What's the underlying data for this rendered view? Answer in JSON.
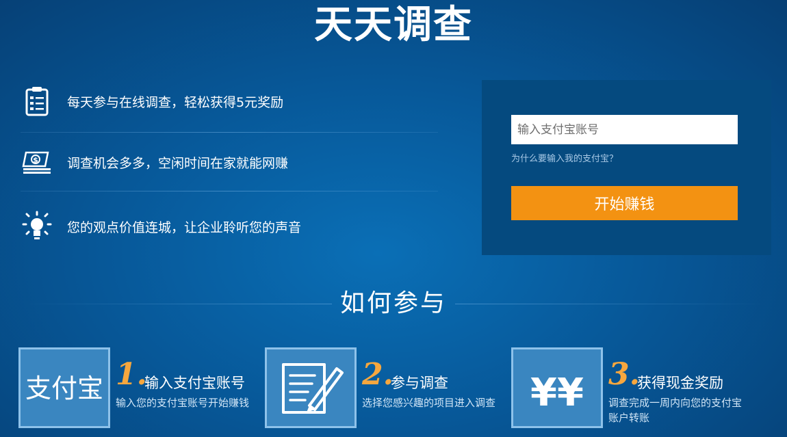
{
  "header": {
    "title": "天天调查"
  },
  "features": [
    {
      "icon": "clipboard-icon",
      "text": "每天参与在线调查，轻松获得5元奖励"
    },
    {
      "icon": "money-icon",
      "text": "调查机会多多，空闲时间在家就能网赚"
    },
    {
      "icon": "lightbulb-icon",
      "text": "您的观点价值连城，让企业聆听您的声音"
    }
  ],
  "login": {
    "placeholder": "输入支付宝账号",
    "why_link": "为什么要输入我的支付宝？",
    "start_label": "开始赚钱"
  },
  "how": {
    "title": "如何参与",
    "steps": [
      {
        "number": "1.",
        "tile_text": "支付宝",
        "title": "输入支付宝账号",
        "desc": "输入您的支付宝账号开始赚钱"
      },
      {
        "number": "2.",
        "title": "参与调查",
        "desc": "选择您感兴趣的项目进入调查"
      },
      {
        "number": "3.",
        "tile_text": "¥¥",
        "title": "获得现金奖励",
        "desc": "调查完成一周内向您的支付宝账户转账"
      }
    ]
  },
  "colors": {
    "accent": "#f39212",
    "panel": "#054a7f",
    "background": "#07599a",
    "step_number": "#f6a73e"
  }
}
